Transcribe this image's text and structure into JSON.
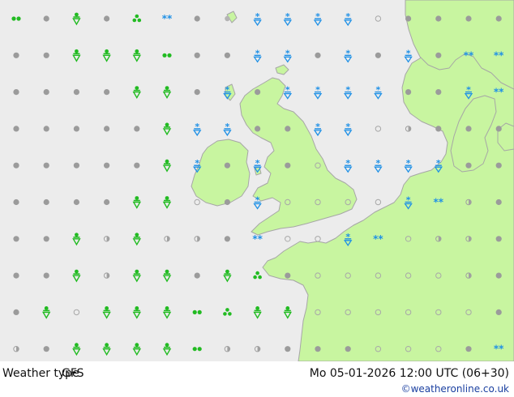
{
  "footer": {
    "title": "Weather type",
    "model": "GFS",
    "valid_time": "Mo 05-01-2026 12:00 UTC (06+30)",
    "credit": "©weatheronline.co.uk"
  },
  "legend_colors": {
    "sea": "#ececec",
    "land": "#c8f5a0",
    "coast": "#a6a6a6",
    "rain": "#22bb22",
    "snow": "#1e90e6",
    "cloud": "#9b9b9b"
  },
  "symbols": [
    [
      "rain-2",
      "cloud",
      "rain-shower",
      "cloud",
      "rain-drizzle",
      "snow-2",
      "cloud",
      "coast",
      "snow-shower",
      "snow-shower",
      "snow-shower",
      "snow-shower",
      "clear",
      "cloud",
      "cloud",
      "cloud",
      "cloud"
    ],
    [
      "cloud",
      "cloud",
      "rain-shower",
      "rain-shower",
      "rain-shower",
      "rain-2",
      "cloud",
      "cloud",
      "snow-shower",
      "snow-shower",
      "cloud",
      "snow-shower",
      "cloud",
      "snow-shower-sm",
      "cloud",
      "snow-2",
      "snow-2"
    ],
    [
      "cloud",
      "cloud",
      "cloud",
      "cloud",
      "rain-shower",
      "rain-shower",
      "cloud",
      "snow-shower",
      "cloud",
      "snow-shower",
      "snow-shower",
      "snow-shower",
      "snow-shower",
      "cloud",
      "cloud",
      "snow-shower",
      "snow-2"
    ],
    [
      "cloud",
      "cloud",
      "cloud",
      "cloud",
      "cloud",
      "rain-shower",
      "snow-shower",
      "snow-shower",
      "cloud",
      "cloud",
      "snow-shower",
      "snow-shower",
      "clear",
      "partly",
      "cloud",
      "cloud",
      "cloud"
    ],
    [
      "cloud",
      "cloud",
      "cloud",
      "cloud",
      "cloud",
      "rain-shower",
      "snow-shower",
      "cloud",
      "snow-shower",
      "cloud",
      "clear",
      "snow-shower",
      "snow-shower",
      "snow-shower",
      "snow-shower",
      "cloud",
      "cloud"
    ],
    [
      "cloud",
      "cloud",
      "cloud",
      "cloud",
      "rain-shower",
      "rain-shower",
      "clear",
      "cloud",
      "snow-shower",
      "clear",
      "clear",
      "clear",
      "clear",
      "snow-shower",
      "snow-2",
      "partly",
      "cloud"
    ],
    [
      "cloud",
      "cloud",
      "rain-shower",
      "partly",
      "rain-shower",
      "partly",
      "partly",
      "cloud",
      "snow-2",
      "clear",
      "clear",
      "snow-shower",
      "snow-2",
      "clear",
      "partly",
      "partly",
      "cloud"
    ],
    [
      "cloud",
      "cloud",
      "rain-shower",
      "partly",
      "rain-shower",
      "rain-shower",
      "cloud",
      "rain-shower",
      "rain-drizzle",
      "cloud",
      "clear",
      "clear",
      "clear",
      "clear",
      "clear",
      "partly",
      "cloud"
    ],
    [
      "cloud",
      "rain-shower",
      "clear",
      "rain-shower",
      "rain-shower",
      "rain-shower",
      "rain-2",
      "rain-drizzle",
      "rain-shower",
      "rain-shower",
      "clear",
      "clear",
      "clear",
      "clear",
      "clear",
      "clear",
      "cloud"
    ],
    [
      "partly",
      "cloud",
      "rain-shower",
      "rain-shower",
      "rain-shower",
      "rain-shower",
      "rain-2",
      "partly",
      "partly",
      "cloud",
      "cloud",
      "cloud",
      "clear",
      "clear",
      "clear",
      "cloud",
      "snow-2"
    ]
  ]
}
